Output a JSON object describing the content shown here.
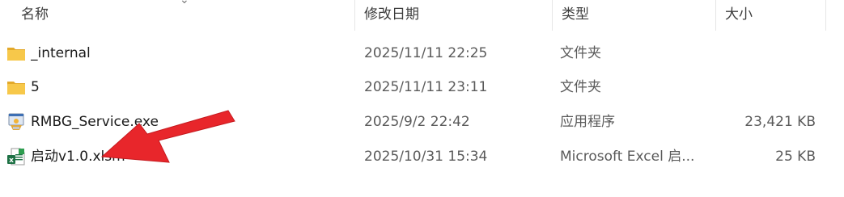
{
  "columns": {
    "name": "名称",
    "date": "修改日期",
    "type": "类型",
    "size": "大小"
  },
  "files": [
    {
      "name": "_internal",
      "date": "2025/11/11 22:25",
      "type": "文件夹",
      "size": "",
      "icon": "folder-icon"
    },
    {
      "name": "5",
      "date": "2025/11/11 23:11",
      "type": "文件夹",
      "size": "",
      "icon": "folder-icon"
    },
    {
      "name": "RMBG_Service.exe",
      "date": "2025/9/2 22:42",
      "type": "应用程序",
      "size": "23,421 KB",
      "icon": "exe-app-icon"
    },
    {
      "name": "启动v1.0.xlsm",
      "date": "2025/10/31 15:34",
      "type": "Microsoft Excel 启...",
      "size": "25 KB",
      "icon": "excel-file-icon"
    }
  ],
  "colors": {
    "folder": "#f7c84a",
    "folder_dark": "#e3a92a",
    "excel_green": "#1e7145",
    "arrow_red": "#e8262b"
  }
}
